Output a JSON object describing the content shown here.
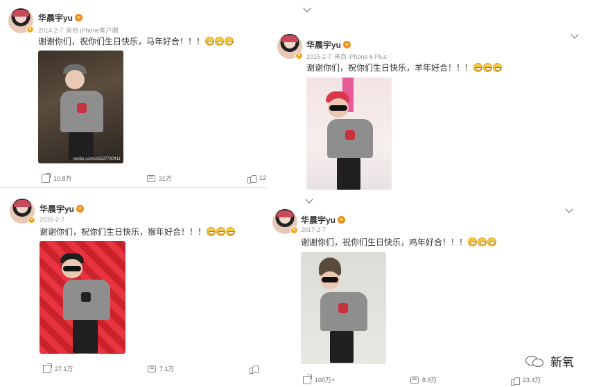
{
  "posts": [
    {
      "author": "华晨宇yu",
      "date": "2014-2-7",
      "source": "来自 iPhone客户端",
      "text": "谢谢你们，祝你们生日快乐，马年好合！！！",
      "photo_watermark": "weibo.com/u/1537790411",
      "shares": "10.8万",
      "comments": "31万",
      "likes": "12"
    },
    {
      "author": "华晨宇yu",
      "date": "2015-2-7",
      "source": "来自 iPhone 6 Plus",
      "text": "谢谢你们，祝你们生日快乐，羊年好合！！！",
      "photo_watermark": "",
      "shares": "",
      "comments": "",
      "likes": ""
    },
    {
      "author": "华晨宇yu",
      "date": "2016-2-7",
      "source": "",
      "text": "谢谢你们，祝你们生日快乐，猴年好合！！！",
      "photo_watermark": "",
      "shares": "27.1万",
      "comments": "7.1万",
      "likes": ""
    },
    {
      "author": "华晨宇yu",
      "date": "2017-2-7",
      "source": "",
      "text": "谢谢你们，祝你们生日快乐，鸡年好合！！！",
      "photo_watermark": "",
      "shares": "100万+",
      "comments": "8.9万",
      "likes": "23.4万"
    }
  ],
  "brand": {
    "name": "新氧"
  },
  "colors": {
    "accent_badge": "#f5a623",
    "text": "#333333",
    "meta": "#999999"
  }
}
